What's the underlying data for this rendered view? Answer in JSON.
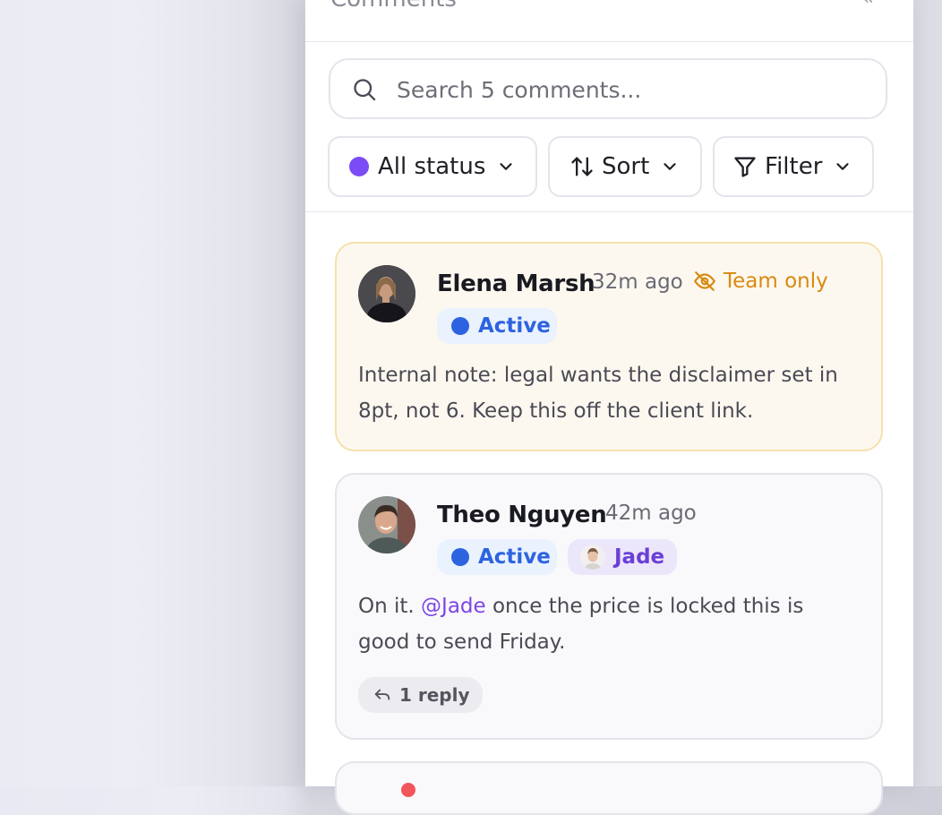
{
  "panel": {
    "header_title": "Comments",
    "header_corner": "«"
  },
  "search": {
    "placeholder": "Search 5 comments..."
  },
  "toolbar": {
    "status_label": "All status",
    "sort_label": "Sort",
    "filter_label": "Filter",
    "status_dot_color": "#7b4cf5"
  },
  "comments": [
    {
      "author": "Elena Marsh",
      "time": "32m ago",
      "visibility": "Team only",
      "status": "Active",
      "body": "Internal note: legal wants the disclaimer set in 8pt, not 6. Keep this off the client link.",
      "avatar_icon": "avatar-elena"
    },
    {
      "author": "Theo Nguyen",
      "time": "42m ago",
      "status": "Active",
      "assignee": "Jade",
      "body_before": "On it. ",
      "mention": "@Jade",
      "body_after": " once the price is locked this is good to send Friday.",
      "reply_label": "1 reply",
      "avatar_icon": "avatar-theo"
    }
  ],
  "colors": {
    "accent_purple": "#7b4cf5",
    "active_blue": "#2e63e0",
    "team_only_orange": "#d88a10",
    "internal_card_bg": "#fdf8ef",
    "mention_purple": "#7d45e6"
  }
}
